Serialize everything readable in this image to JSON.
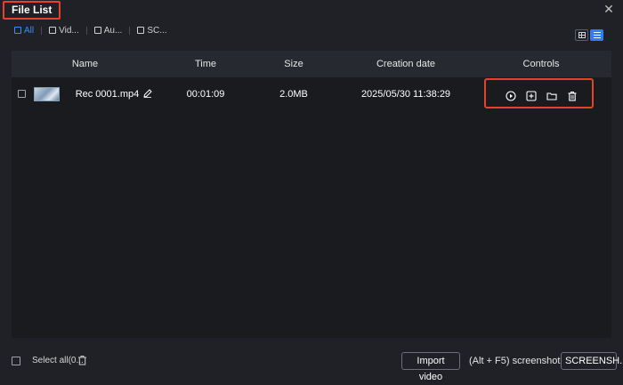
{
  "window": {
    "title": "File List",
    "close_icon": "close-icon"
  },
  "tabs": [
    {
      "label": "All",
      "icon": "file-icon",
      "active": true
    },
    {
      "label": "Vid...",
      "icon": "video-icon",
      "active": false
    },
    {
      "label": "Au...",
      "icon": "audio-icon",
      "active": false
    },
    {
      "label": "SC...",
      "icon": "image-icon",
      "active": false
    }
  ],
  "view": {
    "mode": "list"
  },
  "table": {
    "headers": {
      "name": "Name",
      "time": "Time",
      "size": "Size",
      "created": "Creation date",
      "controls": "Controls"
    },
    "rows": [
      {
        "name": "Rec 0001.mp4",
        "time": "00:01:09",
        "size": "2.0MB",
        "created": "2025/05/30 11:38:29"
      }
    ]
  },
  "footer": {
    "select_all": "Select all(0...",
    "import_video": "Import video",
    "shortcut_hint": "(Alt + F5) screenshot",
    "screenshot_btn": "SCREENSH..."
  },
  "colors": {
    "accent": "#2f7dff",
    "highlight": "#e8402a",
    "background": "#1f2126"
  }
}
